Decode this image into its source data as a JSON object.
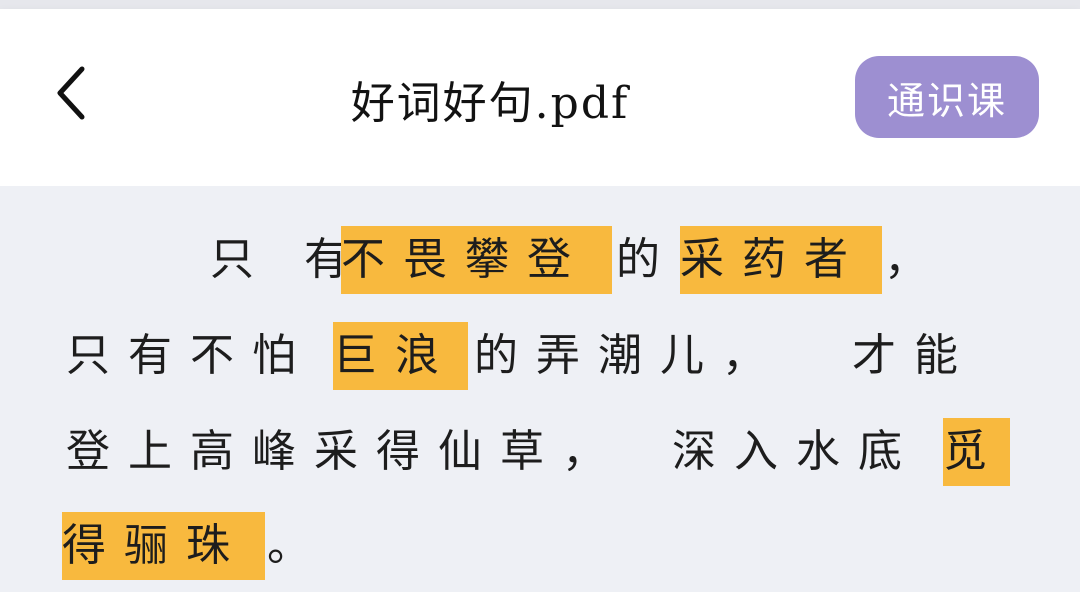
{
  "header": {
    "back_icon": "chevron-left-icon",
    "title": "好词好句.pdf",
    "course_button": "通识课"
  },
  "colors": {
    "accent": "#9d8fd1",
    "highlight": "#f8b93e",
    "background": "#eef0f5",
    "header_bg": "#ffffff"
  },
  "content": {
    "line1": {
      "t1": "只 有",
      "t2": "不畏攀登",
      "t3": "的",
      "t4": "采药者",
      "t5": "，"
    },
    "line2": {
      "t1": "只有不怕",
      "t2": "巨浪",
      "t3": "的弄潮儿，",
      "t4": "才能"
    },
    "line3": {
      "t1": "登上高峰采得仙草，",
      "t2": "深入水底",
      "t3": "觅"
    },
    "line4": {
      "t1": "得骊珠",
      "t2": "。"
    }
  }
}
